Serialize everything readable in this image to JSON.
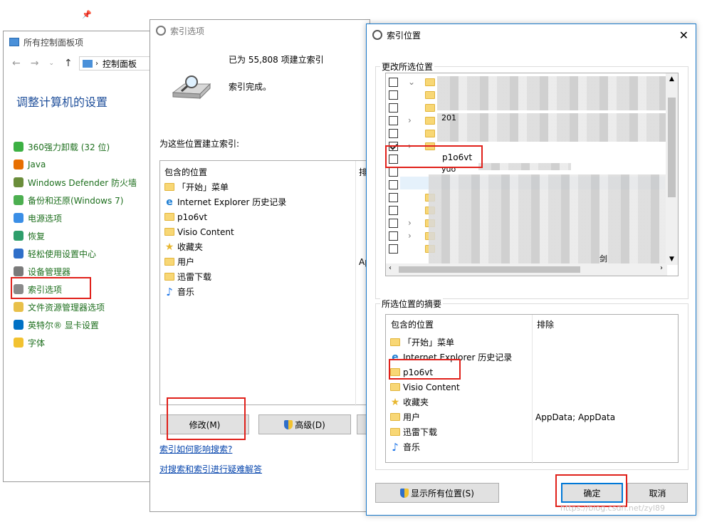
{
  "control_panel": {
    "title": "所有控制面板项",
    "address": "控制面板",
    "heading": "调整计算机的设置",
    "items": [
      {
        "label": "360强力卸载 (32 位)",
        "icon": "uninstall-icon"
      },
      {
        "label": "Java",
        "icon": "java-icon"
      },
      {
        "label": "Windows Defender 防火墙",
        "icon": "firewall-icon"
      },
      {
        "label": "备份和还原(Windows 7)",
        "icon": "backup-icon"
      },
      {
        "label": "电源选项",
        "icon": "power-icon"
      },
      {
        "label": "恢复",
        "icon": "recovery-icon"
      },
      {
        "label": "轻松使用设置中心",
        "icon": "accessibility-icon"
      },
      {
        "label": "设备管理器",
        "icon": "device-manager-icon"
      },
      {
        "label": "索引选项",
        "icon": "indexing-icon"
      },
      {
        "label": "文件资源管理器选项",
        "icon": "folder-options-icon"
      },
      {
        "label": "英特尔® 显卡设置",
        "icon": "intel-icon"
      },
      {
        "label": "字体",
        "icon": "font-icon"
      }
    ]
  },
  "indexing_options": {
    "title": "索引选项",
    "count_text": "已为 55,808 项建立索引",
    "status_text": "索引完成。",
    "section_label": "为这些位置建立索引:",
    "col_included": "包含的位置",
    "col_excluded": "排",
    "excluded_partial": "Ap",
    "locations": [
      {
        "label": "「开始」菜单",
        "icon": "folder-icon"
      },
      {
        "label": "Internet Explorer 历史记录",
        "icon": "ie-icon"
      },
      {
        "label": "p1o6vt",
        "icon": "folder-icon"
      },
      {
        "label": "Visio Content",
        "icon": "folder-icon"
      },
      {
        "label": "收藏夹",
        "icon": "star-icon"
      },
      {
        "label": "用户",
        "icon": "folder-icon"
      },
      {
        "label": "迅雷下载",
        "icon": "folder-icon"
      },
      {
        "label": "音乐",
        "icon": "music-icon"
      }
    ],
    "modify_button": "修改(M)",
    "advanced_button": "高级(D)",
    "link_search": "索引如何影响搜索?",
    "link_troubleshoot": "对搜索和索引进行疑难解答"
  },
  "index_locations": {
    "title": "索引位置",
    "change_label": "更改所选位置",
    "tree_checked_label": "p1o6vt",
    "tree_partial_1": "201",
    "tree_partial_2": "yuo",
    "tree_partial_3": "剑",
    "summary_label": "所选位置的摘要",
    "col_included": "包含的位置",
    "col_excluded": "排除",
    "summary_items": [
      {
        "label": "「开始」菜单",
        "icon": "folder-icon",
        "excluded": ""
      },
      {
        "label": "Internet Explorer 历史记录",
        "icon": "ie-icon",
        "excluded": ""
      },
      {
        "label": "p1o6vt",
        "icon": "folder-icon",
        "excluded": ""
      },
      {
        "label": "Visio Content",
        "icon": "folder-icon",
        "excluded": ""
      },
      {
        "label": "收藏夹",
        "icon": "star-icon",
        "excluded": ""
      },
      {
        "label": "用户",
        "icon": "folder-icon",
        "excluded": "AppData; AppData"
      },
      {
        "label": "迅雷下载",
        "icon": "folder-icon",
        "excluded": ""
      },
      {
        "label": "音乐",
        "icon": "music-icon",
        "excluded": ""
      }
    ],
    "show_all_button": "显示所有位置(S)",
    "ok_button": "确定",
    "cancel_button": "取消",
    "watermark": "https://blog.csdn.net/zyl89"
  }
}
